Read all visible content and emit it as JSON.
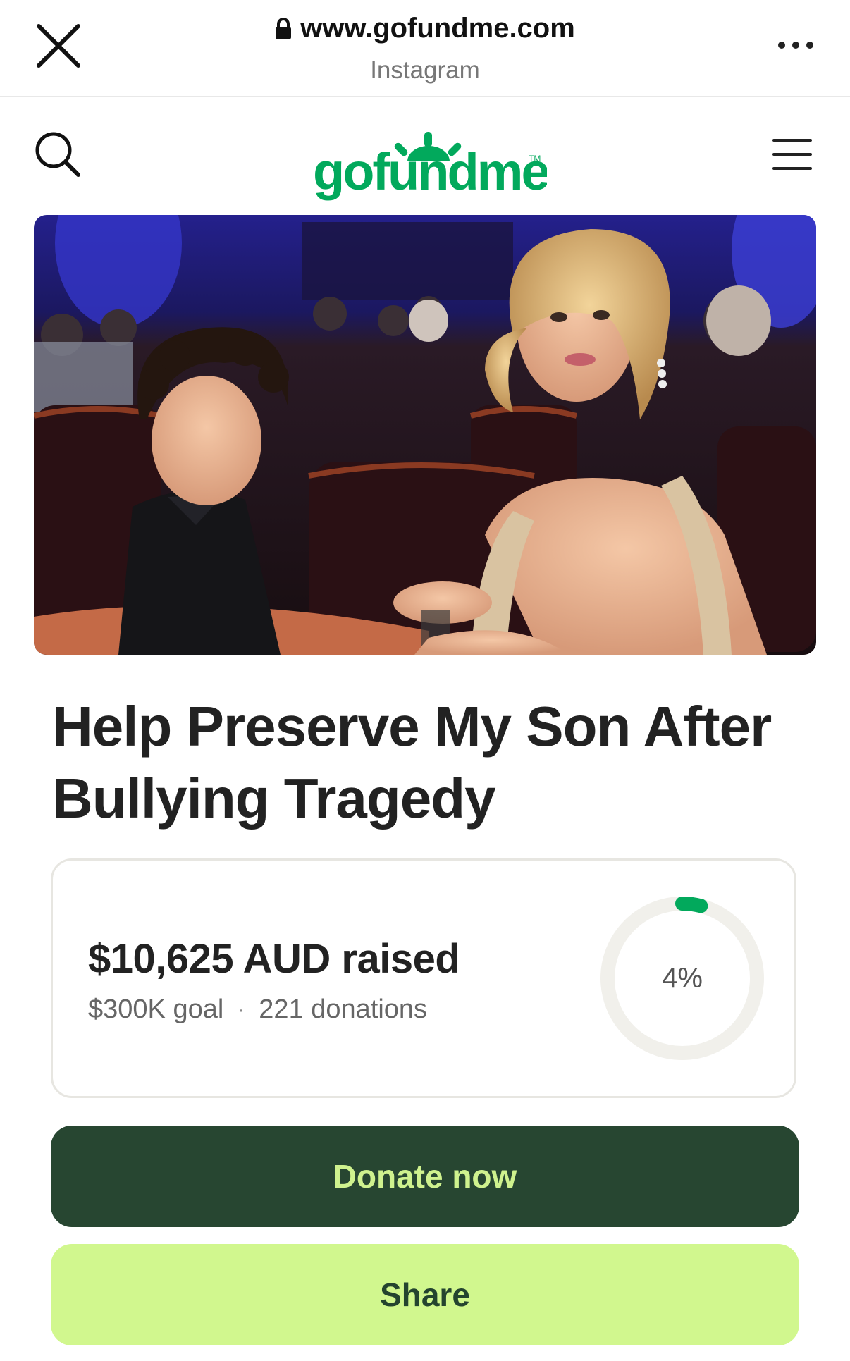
{
  "browser": {
    "url": "www.gofundme.com",
    "source_app": "Instagram"
  },
  "site": {
    "logo_text": "gofundme",
    "brand_color": "#02a95c"
  },
  "campaign": {
    "title": "Help Preserve My Son After Bullying Tragedy",
    "raised_text": "$10,625 AUD raised",
    "goal_text": "$300K goal",
    "separator": "·",
    "donations_text": "221 donations",
    "progress_percent_label": "4%",
    "progress_fraction": 0.04
  },
  "actions": {
    "donate_label": "Donate now",
    "share_label": "Share"
  },
  "colors": {
    "donate_bg": "#274631",
    "donate_text": "#cff28e",
    "share_bg": "#d1f78e",
    "share_text": "#24442f"
  },
  "icons": [
    "close-icon",
    "lock-icon",
    "more-icon",
    "search-icon",
    "menu-icon"
  ]
}
